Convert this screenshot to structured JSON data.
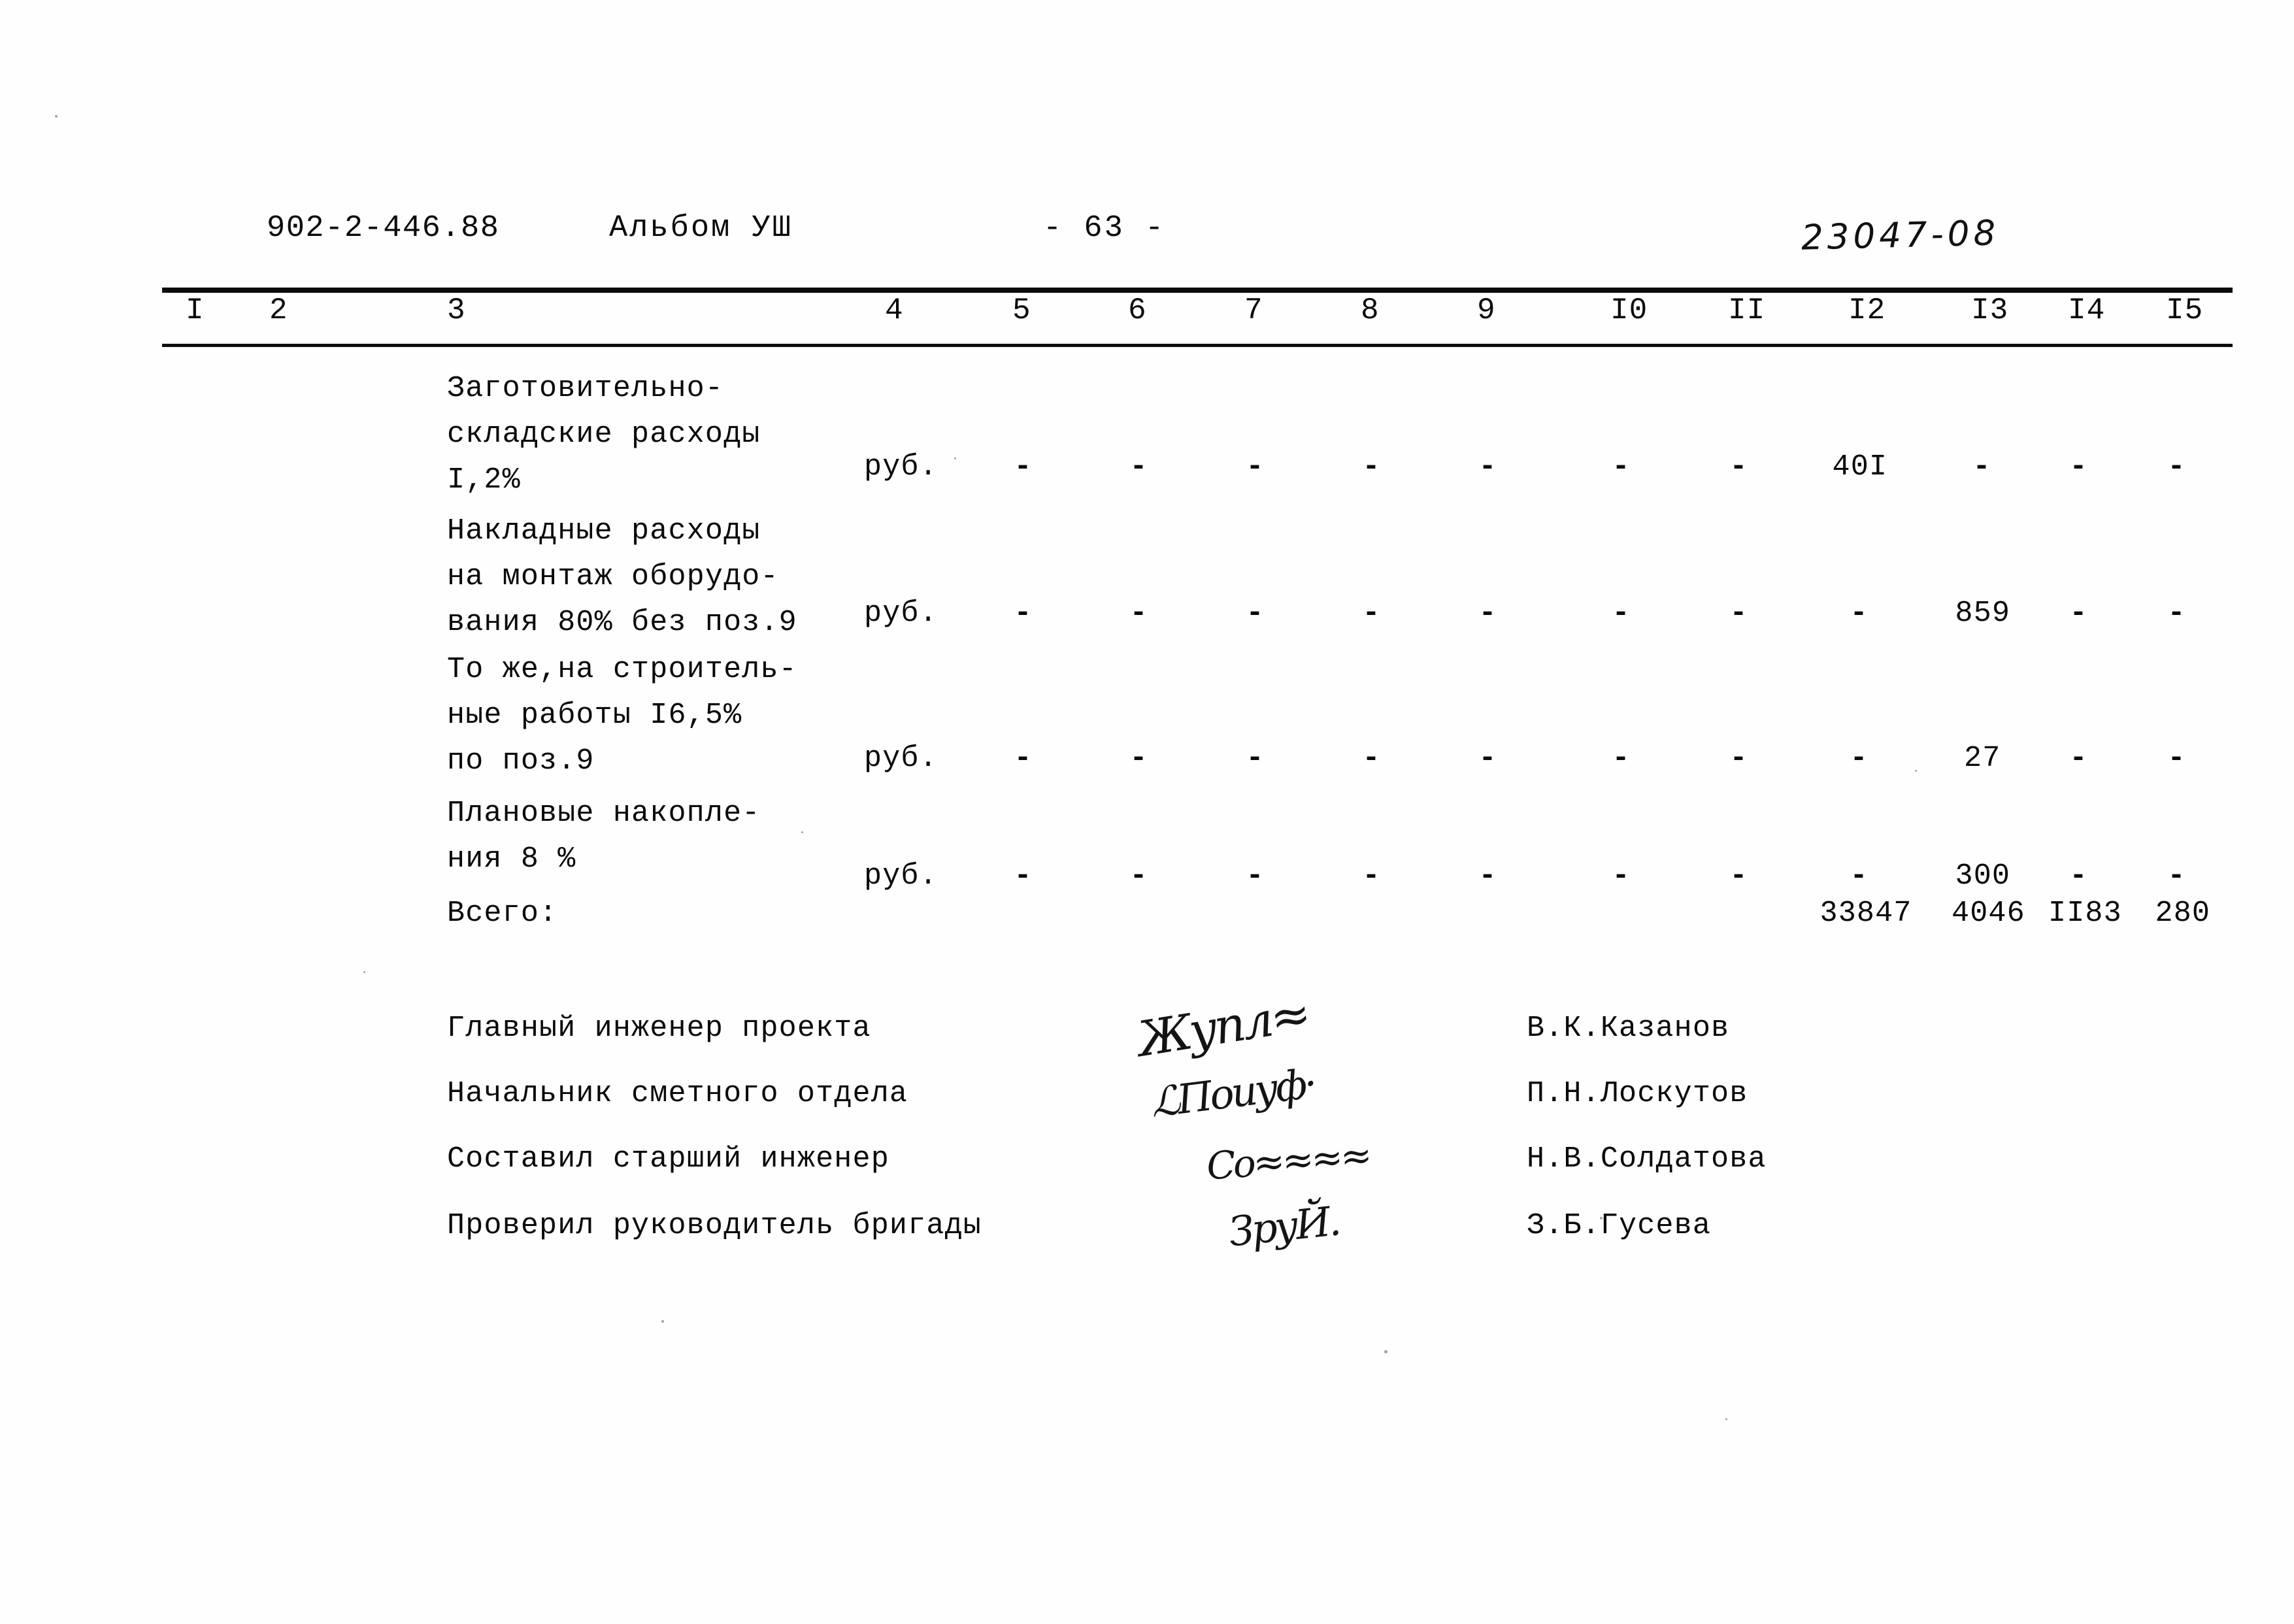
{
  "header": {
    "project_code": "902-2-446.88",
    "album": "Альбом УШ",
    "page_marker": "- 63 -",
    "stamp": "23047-08"
  },
  "table": {
    "column_headers": [
      "I",
      "2",
      "3",
      "4",
      "5",
      "6",
      "7",
      "8",
      "9",
      "I0",
      "II",
      "I2",
      "I3",
      "I4",
      "I5"
    ],
    "dash_symbol": "-",
    "rows": [
      {
        "description_lines": [
          "Заготовительно-",
          "складские расходы",
          "I,2%"
        ],
        "unit": "руб.",
        "values": [
          "",
          "",
          "",
          "",
          "",
          "",
          "",
          "-",
          "-",
          "-",
          "-",
          "-",
          "-",
          "40I",
          "-",
          "-",
          "-"
        ],
        "cells": {
          "c5": "-",
          "c6": "-",
          "c7": "-",
          "c8": "-",
          "c9": "-",
          "c10": "-",
          "c11": "-",
          "c12": "40I",
          "c13": "-",
          "c14": "-",
          "c15": "-"
        }
      },
      {
        "description_lines": [
          "Накладные расходы",
          "на монтаж оборудо-",
          "вания 80% без поз.9"
        ],
        "unit": "руб.",
        "cells": {
          "c5": "-",
          "c6": "-",
          "c7": "-",
          "c8": "-",
          "c9": "-",
          "c10": "-",
          "c11": "-",
          "c12": "-",
          "c13": "859",
          "c14": "-",
          "c15": "-"
        }
      },
      {
        "description_lines": [
          "То же,на строитель-",
          "ные работы I6,5%",
          "по поз.9"
        ],
        "unit": "руб.",
        "cells": {
          "c5": "-",
          "c6": "-",
          "c7": "-",
          "c8": "-",
          "c9": "-",
          "c10": "-",
          "c11": "-",
          "c12": "-",
          "c13": "27",
          "c14": "-",
          "c15": "-"
        }
      },
      {
        "description_lines": [
          "Плановые накопле-",
          "ния 8 %"
        ],
        "unit": "руб.",
        "cells": {
          "c5": "-",
          "c6": "-",
          "c7": "-",
          "c8": "-",
          "c9": "-",
          "c10": "-",
          "c11": "-",
          "c12": "-",
          "c13": "300",
          "c14": "-",
          "c15": "-"
        }
      }
    ],
    "totals": {
      "label": "Всего:",
      "c12": "33847",
      "c13": "4046",
      "c14": "II83",
      "c15": "280"
    }
  },
  "signatures": [
    {
      "title": "Главный инженер проекта",
      "name": "В.К.Казанов"
    },
    {
      "title": "Начальник сметного отдела",
      "name": "П.Н.Лоскутов"
    },
    {
      "title": "Составил   старший инженер",
      "name": "Н.В.Солдатова"
    },
    {
      "title": "Проверил   руководитель бригады",
      "name": "З.Б.Гусева"
    }
  ]
}
